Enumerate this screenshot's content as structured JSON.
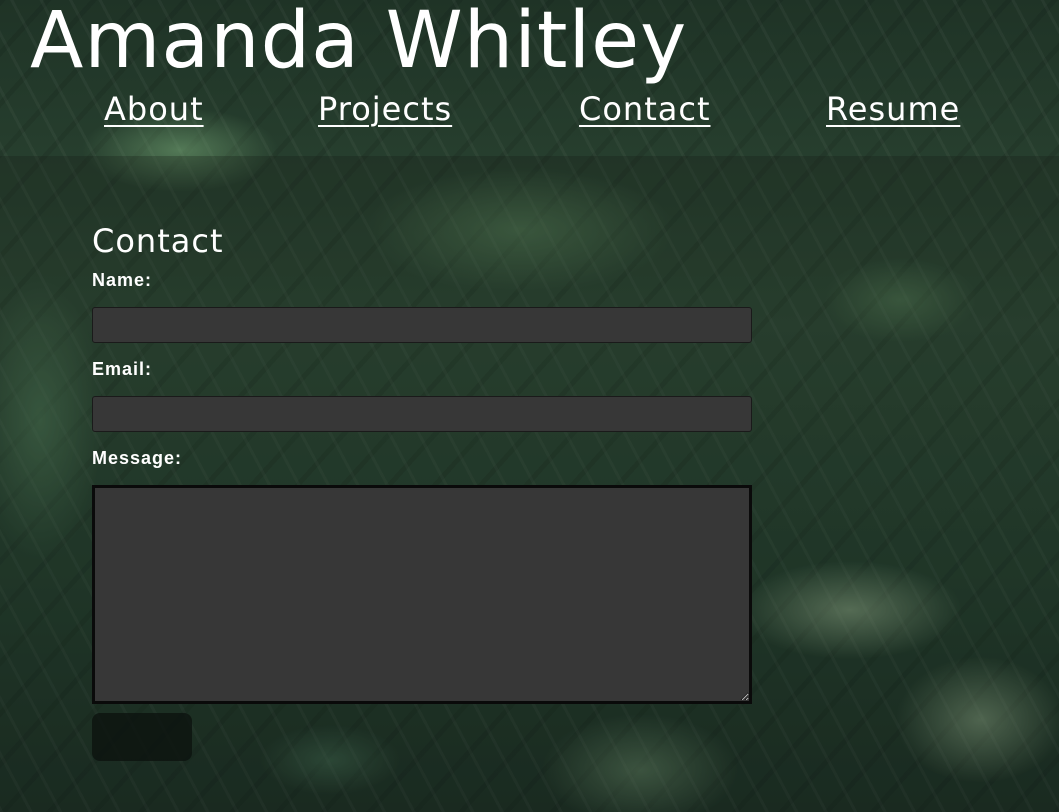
{
  "header": {
    "site_title": "Amanda Whitley",
    "nav": [
      {
        "label": "About"
      },
      {
        "label": "Projects"
      },
      {
        "label": "Contact"
      },
      {
        "label": "Resume"
      }
    ]
  },
  "contact": {
    "heading": "Contact",
    "name_label": "Name:",
    "name_value": "",
    "email_label": "Email:",
    "email_value": "",
    "message_label": "Message:",
    "message_value": "",
    "submit_label": ""
  },
  "colors": {
    "text": "#ffffff",
    "input_background": "#373737",
    "submit_background": "#0c120e"
  }
}
